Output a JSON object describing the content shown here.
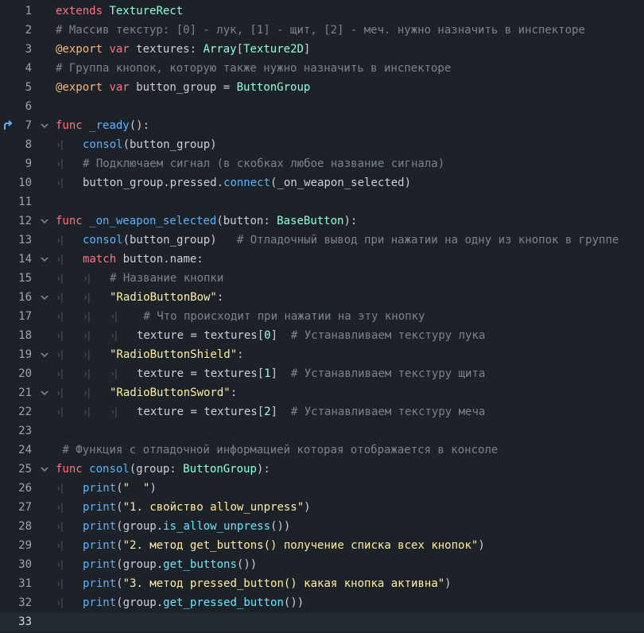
{
  "editor": {
    "current_line": 33,
    "lines": [
      {
        "n": "1",
        "indent": 0,
        "tokens": [
          {
            "t": "extends",
            "c": "kw"
          },
          {
            "t": " ",
            "c": "pl"
          },
          {
            "t": "TextureRect",
            "c": "ty"
          }
        ]
      },
      {
        "n": "2",
        "indent": 0,
        "tokens": [
          {
            "t": "# Массив текстур: [0] - лук, [1] - щит, [2] - меч. нужно назначить в инспекторе",
            "c": "cm"
          }
        ]
      },
      {
        "n": "3",
        "indent": 0,
        "tokens": [
          {
            "t": "@export",
            "c": "an"
          },
          {
            "t": " ",
            "c": "pl"
          },
          {
            "t": "var",
            "c": "kw"
          },
          {
            "t": " textures: ",
            "c": "pl"
          },
          {
            "t": "Array",
            "c": "ty"
          },
          {
            "t": "[",
            "c": "pl"
          },
          {
            "t": "Texture2D",
            "c": "ty"
          },
          {
            "t": "]",
            "c": "pl"
          }
        ]
      },
      {
        "n": "4",
        "indent": 0,
        "tokens": [
          {
            "t": "# Группа кнопок, которую также нужно назначить в инспекторе",
            "c": "cm"
          }
        ]
      },
      {
        "n": "5",
        "indent": 0,
        "tokens": [
          {
            "t": "@export",
            "c": "an"
          },
          {
            "t": " ",
            "c": "pl"
          },
          {
            "t": "var",
            "c": "kw"
          },
          {
            "t": " button_group = ",
            "c": "pl"
          },
          {
            "t": "ButtonGroup",
            "c": "ty"
          }
        ]
      },
      {
        "n": "6",
        "indent": 0,
        "tokens": []
      },
      {
        "n": "7",
        "indent": 0,
        "bookmark": true,
        "fold": true,
        "tokens": [
          {
            "t": "func",
            "c": "kw"
          },
          {
            "t": " ",
            "c": "pl"
          },
          {
            "t": "_ready",
            "c": "fn"
          },
          {
            "t": "():",
            "c": "pl"
          }
        ]
      },
      {
        "n": "8",
        "indent": 1,
        "tokens": [
          {
            "t": "consol",
            "c": "fn"
          },
          {
            "t": "(button_group)",
            "c": "pl"
          }
        ]
      },
      {
        "n": "9",
        "indent": 1,
        "tokens": [
          {
            "t": "# Подключаем сигнал (в скобках любое название сигнала)",
            "c": "cm"
          }
        ]
      },
      {
        "n": "10",
        "indent": 1,
        "tokens": [
          {
            "t": "button_group.pressed.",
            "c": "pl"
          },
          {
            "t": "connect",
            "c": "fn"
          },
          {
            "t": "(_on_weapon_selected)",
            "c": "pl"
          }
        ]
      },
      {
        "n": "11",
        "indent": 0,
        "tokens": []
      },
      {
        "n": "12",
        "indent": 0,
        "fold": true,
        "tokens": [
          {
            "t": "func",
            "c": "kw"
          },
          {
            "t": " ",
            "c": "pl"
          },
          {
            "t": "_on_weapon_selected",
            "c": "fn"
          },
          {
            "t": "(button: ",
            "c": "pl"
          },
          {
            "t": "BaseButton",
            "c": "ty"
          },
          {
            "t": "):",
            "c": "pl"
          }
        ]
      },
      {
        "n": "13",
        "indent": 1,
        "tokens": [
          {
            "t": "consol",
            "c": "fn"
          },
          {
            "t": "(button_group)   ",
            "c": "pl"
          },
          {
            "t": "# Отладочный вывод при нажатии на одну из кнопок в группе",
            "c": "cm"
          }
        ]
      },
      {
        "n": "14",
        "indent": 1,
        "fold": true,
        "tokens": [
          {
            "t": "match",
            "c": "kw"
          },
          {
            "t": " button.name:",
            "c": "pl"
          }
        ]
      },
      {
        "n": "15",
        "indent": 2,
        "tokens": [
          {
            "t": "# Название кнопки",
            "c": "cm"
          }
        ]
      },
      {
        "n": "16",
        "indent": 2,
        "fold": true,
        "tokens": [
          {
            "t": "\"RadioButtonBow\"",
            "c": "st"
          },
          {
            "t": ":",
            "c": "pl"
          }
        ]
      },
      {
        "n": "17",
        "indent": 3,
        "tokens": [
          {
            "t": " # Что происходит при нажатии на эту кнопку",
            "c": "cm"
          }
        ]
      },
      {
        "n": "18",
        "indent": 3,
        "tokens": [
          {
            "t": "texture = textures[",
            "c": "pl"
          },
          {
            "t": "0",
            "c": "nm"
          },
          {
            "t": "]  ",
            "c": "pl"
          },
          {
            "t": "# Устанавливаем текстуру лука",
            "c": "cm"
          }
        ]
      },
      {
        "n": "19",
        "indent": 2,
        "fold": true,
        "tokens": [
          {
            "t": "\"RadioButtonShield\"",
            "c": "st"
          },
          {
            "t": ":",
            "c": "pl"
          }
        ]
      },
      {
        "n": "20",
        "indent": 3,
        "tokens": [
          {
            "t": "texture = textures[",
            "c": "pl"
          },
          {
            "t": "1",
            "c": "nm"
          },
          {
            "t": "]  ",
            "c": "pl"
          },
          {
            "t": "# Устанавливаем текстуру щита",
            "c": "cm"
          }
        ]
      },
      {
        "n": "21",
        "indent": 2,
        "fold": true,
        "tokens": [
          {
            "t": "\"RadioButtonSword\"",
            "c": "st"
          },
          {
            "t": ":",
            "c": "pl"
          }
        ]
      },
      {
        "n": "22",
        "indent": 3,
        "tokens": [
          {
            "t": "texture = textures[",
            "c": "pl"
          },
          {
            "t": "2",
            "c": "nm"
          },
          {
            "t": "]  ",
            "c": "pl"
          },
          {
            "t": "# Устанавливаем текстуру меча",
            "c": "cm"
          }
        ]
      },
      {
        "n": "23",
        "indent": 0,
        "tokens": []
      },
      {
        "n": "24",
        "indent": 0,
        "tokens": [
          {
            "t": " # Функция с отладочной информацией которая отображается в консоле",
            "c": "cm"
          }
        ]
      },
      {
        "n": "25",
        "indent": 0,
        "fold": true,
        "tokens": [
          {
            "t": "func",
            "c": "kw"
          },
          {
            "t": " ",
            "c": "pl"
          },
          {
            "t": "consol",
            "c": "fn"
          },
          {
            "t": "(group: ",
            "c": "pl"
          },
          {
            "t": "ButtonGroup",
            "c": "ty"
          },
          {
            "t": "):",
            "c": "pl"
          }
        ]
      },
      {
        "n": "26",
        "indent": 1,
        "tokens": [
          {
            "t": "print",
            "c": "fn"
          },
          {
            "t": "(",
            "c": "pl"
          },
          {
            "t": "\"  \"",
            "c": "st"
          },
          {
            "t": ")",
            "c": "pl"
          }
        ]
      },
      {
        "n": "27",
        "indent": 1,
        "tokens": [
          {
            "t": "print",
            "c": "fn"
          },
          {
            "t": "(",
            "c": "pl"
          },
          {
            "t": "\"1. свойство allow_unpress\"",
            "c": "st"
          },
          {
            "t": ")",
            "c": "pl"
          }
        ]
      },
      {
        "n": "28",
        "indent": 1,
        "tokens": [
          {
            "t": "print",
            "c": "fn"
          },
          {
            "t": "(group.",
            "c": "pl"
          },
          {
            "t": "is_allow_unpress",
            "c": "dc"
          },
          {
            "t": "())",
            "c": "pl"
          }
        ]
      },
      {
        "n": "29",
        "indent": 1,
        "tokens": [
          {
            "t": "print",
            "c": "fn"
          },
          {
            "t": "(",
            "c": "pl"
          },
          {
            "t": "\"2. метод get_buttons() получение списка всех кнопок\"",
            "c": "st"
          },
          {
            "t": ")",
            "c": "pl"
          }
        ]
      },
      {
        "n": "30",
        "indent": 1,
        "tokens": [
          {
            "t": "print",
            "c": "fn"
          },
          {
            "t": "(group.",
            "c": "pl"
          },
          {
            "t": "get_buttons",
            "c": "dc"
          },
          {
            "t": "())",
            "c": "pl"
          }
        ]
      },
      {
        "n": "31",
        "indent": 1,
        "tokens": [
          {
            "t": "print",
            "c": "fn"
          },
          {
            "t": "(",
            "c": "pl"
          },
          {
            "t": "\"3. метод pressed_button() какая кнопка активна\"",
            "c": "st"
          },
          {
            "t": ")",
            "c": "pl"
          }
        ]
      },
      {
        "n": "32",
        "indent": 1,
        "tokens": [
          {
            "t": "print",
            "c": "fn"
          },
          {
            "t": "(group.",
            "c": "pl"
          },
          {
            "t": "get_pressed_button",
            "c": "dc"
          },
          {
            "t": "())",
            "c": "pl"
          }
        ]
      },
      {
        "n": "33",
        "indent": 0,
        "tokens": []
      }
    ]
  },
  "icons": {
    "bookmark": "connected-signal-icon",
    "fold": "chevron-down-icon",
    "tab": "tab-indent-icon"
  },
  "colors": {
    "background": "#1d2229",
    "current_line": "#242a32",
    "keyword": "#ff7085",
    "type": "#8effda",
    "annotation": "#ffb373",
    "function": "#57b3ff",
    "comment": "#7d838b",
    "string": "#ffeda1"
  }
}
